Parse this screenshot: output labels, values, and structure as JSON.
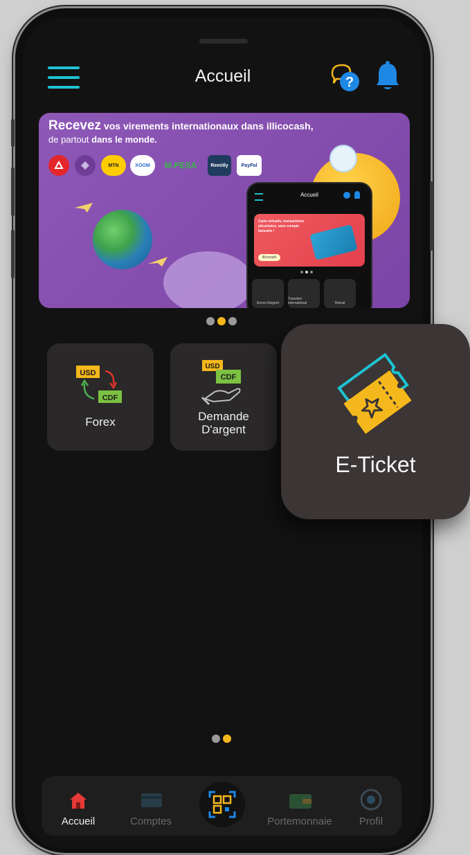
{
  "header": {
    "title": "Accueil"
  },
  "banner": {
    "headline_bold": "Recevez",
    "headline_rest": " vos virements internationaux dans illicocash,",
    "line2_start": "de partout ",
    "line2_bold": "dans le monde.",
    "partners": [
      "MTN",
      "XOOM",
      "M-PESA",
      "Remitly",
      "PayPal"
    ],
    "mini_app": {
      "title": "Accueil",
      "card_text": "Carte virtuelle, transactions sécurisées, sans compte bancaire !",
      "logo": "illicocash",
      "tiles": [
        "Envoi d'argent",
        "Transfert international",
        "Retrait"
      ]
    }
  },
  "carousel": {
    "banner_page": 2,
    "banner_pages": 3,
    "grid_page": 2,
    "grid_pages": 2
  },
  "services": [
    {
      "label": "Forex",
      "icon": "currency-exchange-icon"
    },
    {
      "label": "Demande\nD'argent",
      "icon": "money-request-icon"
    }
  ],
  "currency": {
    "from": "USD",
    "to": "CDF"
  },
  "eticket": {
    "label": "E-Ticket",
    "icon": "ticket-icon"
  },
  "nav": [
    {
      "label": "Accueil",
      "icon": "home-icon",
      "active": true
    },
    {
      "label": "Comptes",
      "icon": "card-icon",
      "active": false
    },
    {
      "label": "",
      "icon": "qr-scan-icon",
      "active": false
    },
    {
      "label": "Portemonnaie",
      "icon": "wallet-icon",
      "active": false
    },
    {
      "label": "Profil",
      "icon": "profile-icon",
      "active": false
    }
  ],
  "colors": {
    "accent_cyan": "#1ec2d3",
    "accent_blue": "#1e88e5",
    "accent_yellow": "#f5b81c",
    "banner_purple": "#8e58b7",
    "tile_bg": "#2a2828",
    "screen_bg": "#131212"
  }
}
